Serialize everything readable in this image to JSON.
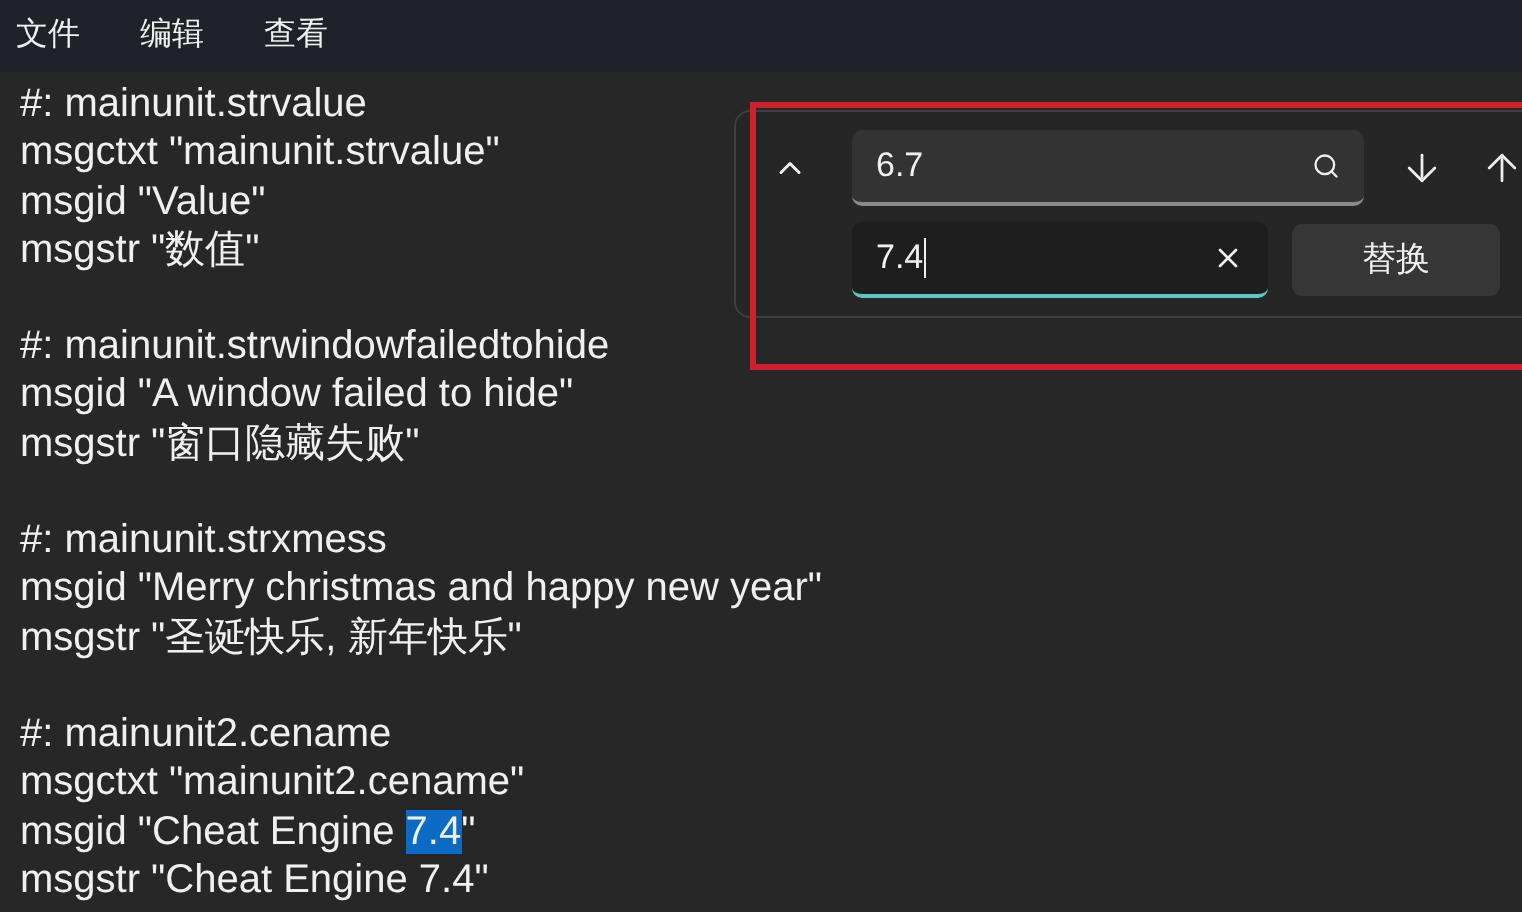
{
  "menu": [
    "文件",
    "编辑",
    "查看"
  ],
  "entries": [
    {
      "lines": [
        [
          {
            "text": "#: mainunit.strvalue",
            "selected": false
          }
        ],
        [
          {
            "text": "msgctxt \"mainunit.strvalue\"",
            "selected": false
          }
        ],
        [
          {
            "text": "msgid \"Value\"",
            "selected": false
          }
        ],
        [
          {
            "text": "msgstr \"数值\"",
            "selected": false
          }
        ]
      ]
    },
    {
      "lines": [
        [
          {
            "text": "#: mainunit.strwindowfailedtohide",
            "selected": false
          }
        ],
        [
          {
            "text": "msgid \"A window failed to hide\"",
            "selected": false
          }
        ],
        [
          {
            "text": "msgstr \"窗口隐藏失败\"",
            "selected": false
          }
        ]
      ]
    },
    {
      "lines": [
        [
          {
            "text": "#: mainunit.strxmess",
            "selected": false
          }
        ],
        [
          {
            "text": "msgid \"Merry christmas and happy new year\"",
            "selected": false
          }
        ],
        [
          {
            "text": "msgstr \"圣诞快乐, 新年快乐\"",
            "selected": false
          }
        ]
      ]
    },
    {
      "lines": [
        [
          {
            "text": "#: mainunit2.cename",
            "selected": false
          }
        ],
        [
          {
            "text": "msgctxt \"mainunit2.cename\"",
            "selected": false
          }
        ],
        [
          {
            "text": "msgid \"Cheat Engine ",
            "selected": false
          },
          {
            "text": "7.4",
            "selected": true
          },
          {
            "text": "\"",
            "selected": false
          }
        ],
        [
          {
            "text": "msgstr \"Cheat Engine 7.4\"",
            "selected": false
          }
        ]
      ]
    }
  ],
  "find": {
    "expanded": true,
    "search_value": "6.7",
    "replace_value": "7.4",
    "replace_button": "替换"
  }
}
